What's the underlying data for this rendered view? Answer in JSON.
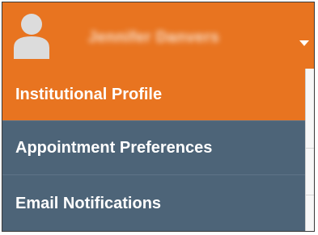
{
  "header": {
    "user_name": "Jennifer Danvers",
    "avatar_icon": "user-avatar-icon",
    "dropdown_icon": "caret-down-icon",
    "accent_color": "#e87420"
  },
  "menu": {
    "background_color": "#4d6478",
    "items": [
      {
        "label": "Institutional Profile",
        "active": true
      },
      {
        "label": "Appointment Preferences",
        "active": false
      },
      {
        "label": "Email Notifications",
        "active": false
      }
    ]
  }
}
